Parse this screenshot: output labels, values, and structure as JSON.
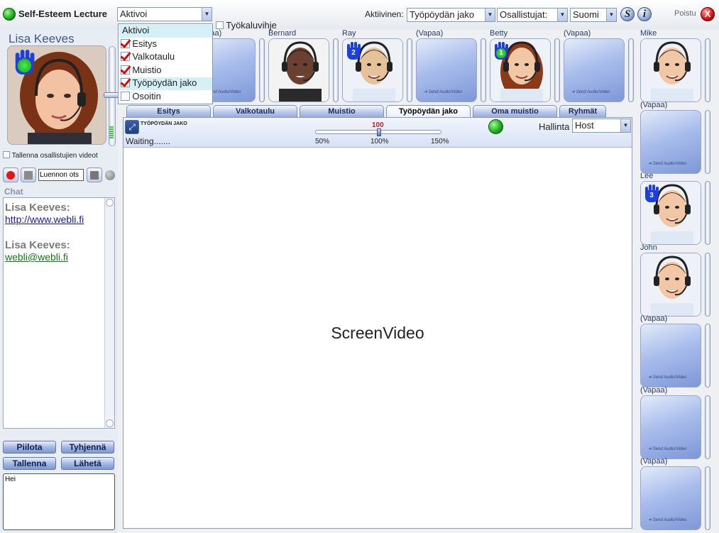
{
  "app": {
    "title": "Self-Esteem Lecture"
  },
  "header": {
    "activate_select": "Aktivoi",
    "tooltips_label": "Työkaluvihje",
    "active_label": "Aktiivinen:",
    "active_value": "Työpöydän jako",
    "participants_select": "Osallistujat:",
    "language_select": "Suomi",
    "s_button": "S",
    "info_button": "i",
    "exit_label": "Poistu",
    "exit_icon": "X"
  },
  "dropdown": {
    "items": [
      {
        "label": "Aktivoi",
        "checked": false
      },
      {
        "label": "Esitys",
        "checked": true
      },
      {
        "label": "Valkotaulu",
        "checked": true
      },
      {
        "label": "Muistio",
        "checked": true
      },
      {
        "label": "Työpöydän jako",
        "checked": true
      },
      {
        "label": "Osoitin",
        "checked": false
      }
    ]
  },
  "presenter": {
    "name": "Lisa Keeves",
    "record_videos_label": "Tallenna osallistujien videot",
    "lecture_title_input": "Luennon ots"
  },
  "chat": {
    "title": "Chat",
    "messages": [
      {
        "author": "Lisa Keeves:",
        "text": "http://www.webli.fi"
      },
      {
        "author": "Lisa Keeves:",
        "text": "webli@webli.fi"
      }
    ],
    "buttons": {
      "hide": "Piilota",
      "clear": "Tyhjennä",
      "save": "Tallenna",
      "send": "Lähetä"
    },
    "input_value": "Hei"
  },
  "top_tiles": [
    {
      "name": "(Vapaa)",
      "empty": true,
      "sav": "Send Audio/Video"
    },
    {
      "name": "Bernard",
      "empty": false
    },
    {
      "name": "Ray",
      "empty": false,
      "hand": "2"
    },
    {
      "name": "(Vapaa)",
      "empty": true,
      "sav": "Send Audio/Video"
    },
    {
      "name": "Betty",
      "empty": false,
      "hand": "1"
    },
    {
      "name": "(Vapaa)",
      "empty": true,
      "sav": "Send Audio/Video"
    }
  ],
  "right_tiles": [
    {
      "name": "Mike",
      "empty": false
    },
    {
      "name": "(Vapaa)",
      "empty": true,
      "sav": "Send Audio/Video"
    },
    {
      "name": "Lee",
      "empty": false,
      "hand": "3"
    },
    {
      "name": "John",
      "empty": false
    },
    {
      "name": "(Vapaa)",
      "empty": true,
      "sav": "Send Audio/Video"
    },
    {
      "name": "(Vapaa)",
      "empty": true,
      "sav": "Send Audio/Video"
    },
    {
      "name": "(Vapaa)",
      "empty": true,
      "sav": "Send Audio/Video"
    }
  ],
  "tabs": [
    "Esitys",
    "Valkotaulu",
    "Muistio",
    "Työpöydän jako",
    "Oma muistio",
    "Ryhmät"
  ],
  "active_tab": 3,
  "screenshare": {
    "title": "TYÖPÖYDÄN JAKO",
    "status": "Waiting.......",
    "zoom_value": "100",
    "zoom_level": 100,
    "zoom_ticks": [
      "50%",
      "100%",
      "150%"
    ],
    "control_label": "Hallinta",
    "control_value": "Host",
    "content_label": "ScreenVideo"
  },
  "colors": {
    "accent": "#7f98d0",
    "status_green": "#1aa41a",
    "exit_red": "#d41010",
    "hand_blue": "#1c3fe0"
  }
}
